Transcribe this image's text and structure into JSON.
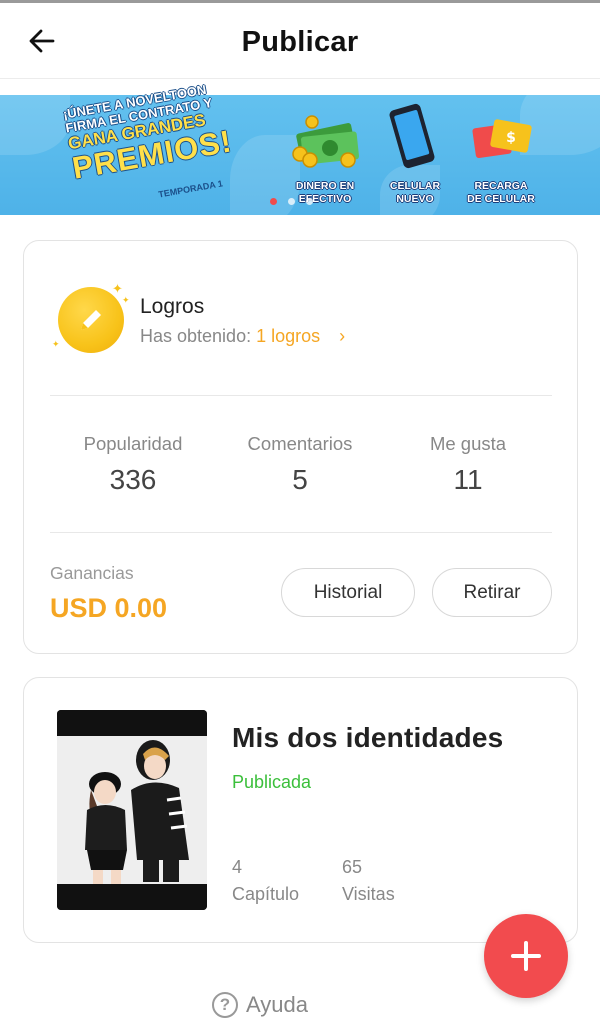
{
  "header": {
    "title": "Publicar",
    "back_icon": "arrow-left-icon"
  },
  "banner": {
    "headline_line1": "¡ÚNETE A NOVELTOON",
    "headline_line2": "FIRMA EL CONTRATO Y",
    "headline_line3": "GANA GRANDES",
    "headline_line4": "PREMIOS!",
    "season": "TEMPORADA 1",
    "prizes": [
      {
        "label_line1": "DINERO EN",
        "label_line2": "EFECTIVO",
        "icon": "cash-money-icon"
      },
      {
        "label_line1": "CELULAR",
        "label_line2": "NUEVO",
        "icon": "smartphone-icon"
      },
      {
        "label_line1": "RECARGA",
        "label_line2": "DE CELULAR",
        "icon": "recharge-card-icon"
      }
    ],
    "active_slide": 1,
    "slide_count": 3,
    "colors": {
      "background": "#55b7eb",
      "headline_accent": "#ffe04a",
      "active_dot": "#f04b4b"
    }
  },
  "achievements": {
    "title": "Logros",
    "subtitle_prefix": "Has obtenido:",
    "subtitle_value": "1 logros",
    "icon": "pencil-medal-icon"
  },
  "stats": [
    {
      "label": "Popularidad",
      "value": "336"
    },
    {
      "label": "Comentarios",
      "value": "5"
    },
    {
      "label": "Me gusta",
      "value": "11"
    }
  ],
  "earnings": {
    "label": "Ganancias",
    "value": "USD 0.00",
    "history_button": "Historial",
    "withdraw_button": "Retirar",
    "accent_color": "#f5a623"
  },
  "book": {
    "title": "Mis dos identidades",
    "status": "Publicada",
    "status_color": "#3bbf3b",
    "chapters_value": "4",
    "chapters_label": "Capítulo",
    "visits_value": "65",
    "visits_label": "Visitas"
  },
  "fab": {
    "icon": "plus-icon",
    "color": "#f24b4e"
  },
  "help": {
    "label": "Ayuda",
    "icon": "question-circle-icon"
  }
}
